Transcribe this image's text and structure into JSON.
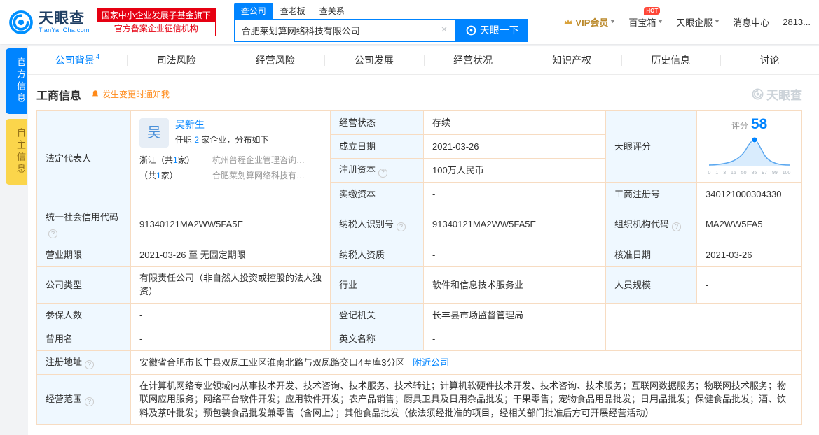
{
  "header": {
    "logo": {
      "title": "天眼查",
      "subtitle": "TianYanCha.com"
    },
    "badge": {
      "line1": "国家中小企业发展子基金旗下",
      "line2": "官方备案企业征信机构"
    },
    "search": {
      "tabs": [
        {
          "label": "查公司"
        },
        {
          "label": "查老板"
        },
        {
          "label": "查关系"
        }
      ],
      "value": "合肥莱划算网络科技有限公司",
      "clear": "×",
      "button": "天眼一下"
    },
    "right": {
      "vip": "VIP会员",
      "treasure": "百宝箱",
      "hot": "HOT",
      "enterprise": "天眼企服",
      "messages": "消息中心",
      "count": "2813..."
    }
  },
  "side_tabs": [
    {
      "label": "官方信息"
    },
    {
      "label": "自主信息"
    }
  ],
  "nav": {
    "tabs": [
      {
        "label": "公司背景",
        "count": "4"
      },
      {
        "label": "司法风险"
      },
      {
        "label": "经营风险"
      },
      {
        "label": "公司发展"
      },
      {
        "label": "经营状况"
      },
      {
        "label": "知识产权"
      },
      {
        "label": "历史信息"
      },
      {
        "label": "讨论"
      }
    ]
  },
  "section": {
    "title": "工商信息",
    "notify": "发生变更时通知我",
    "watermark": "天眼查"
  },
  "legal_rep": {
    "label": "法定代表人",
    "avatar": "吴",
    "name": "吴新生",
    "role_pre": "任职",
    "role_count": "2",
    "role_post": "家企业，分布如下",
    "rows": [
      {
        "pre": "浙江（共",
        "num": "1",
        "post": "家）",
        "company": "杭州普程企业管理咨询…"
      },
      {
        "pre": "（共",
        "num": "1",
        "post": "家）",
        "company": "合肥莱划算网络科技有…"
      }
    ]
  },
  "score": {
    "label": "天眼评分",
    "caption": "评分",
    "value": "58",
    "axis": [
      "0",
      "1",
      "3",
      "15",
      "50",
      "85",
      "97",
      "99",
      "100"
    ]
  },
  "fields": {
    "business_status": {
      "label": "经营状态",
      "value": "存续"
    },
    "established": {
      "label": "成立日期",
      "value": "2021-03-26"
    },
    "registered_capital": {
      "label": "注册资本",
      "value": "100万人民币"
    },
    "paid_in_capital": {
      "label": "实缴资本",
      "value": "-"
    },
    "registration_no": {
      "label": "工商注册号",
      "value": "340121000304330"
    },
    "credit_code": {
      "label": "统一社会信用代码",
      "value": "91340121MA2WW5FA5E"
    },
    "taxpayer_id": {
      "label": "纳税人识别号",
      "value": "91340121MA2WW5FA5E"
    },
    "org_code": {
      "label": "组织机构代码",
      "value": "MA2WW5FA5"
    },
    "business_term": {
      "label": "营业期限",
      "value": "2021-03-26 至 无固定期限"
    },
    "taxpayer_qualification": {
      "label": "纳税人资质",
      "value": "-"
    },
    "approval_date": {
      "label": "核准日期",
      "value": "2021-03-26"
    },
    "company_type": {
      "label": "公司类型",
      "value": "有限责任公司（非自然人投资或控股的法人独资）"
    },
    "industry": {
      "label": "行业",
      "value": "软件和信息技术服务业"
    },
    "staff_size": {
      "label": "人员规模",
      "value": "-"
    },
    "insured_count": {
      "label": "参保人数",
      "value": "-"
    },
    "registration_authority": {
      "label": "登记机关",
      "value": "长丰县市场监督管理局"
    },
    "former_name": {
      "label": "曾用名",
      "value": "-"
    },
    "english_name": {
      "label": "英文名称",
      "value": "-"
    },
    "registered_address": {
      "label": "注册地址",
      "value": "安徽省合肥市长丰县双凤工业区淮南北路与双凤路交口4＃库3分区",
      "link": "附近公司"
    },
    "business_scope": {
      "label": "经营范围",
      "value": "在计算机网络专业领域内从事技术开发、技术咨询、技术服务、技术转让；计算机软硬件技术开发、技术咨询、技术服务；互联网数据服务；物联网技术服务；物联网应用服务；网络平台软件开发；应用软件开发；农产品销售；厨具卫具及日用杂品批发；干果零售；宠物食品用品批发；日用品批发；保健食品批发；酒、饮料及茶叶批发；预包装食品批发兼零售（含网上）；其他食品批发（依法须经批准的项目，经相关部门批准后方可开展经营活动）"
    }
  }
}
